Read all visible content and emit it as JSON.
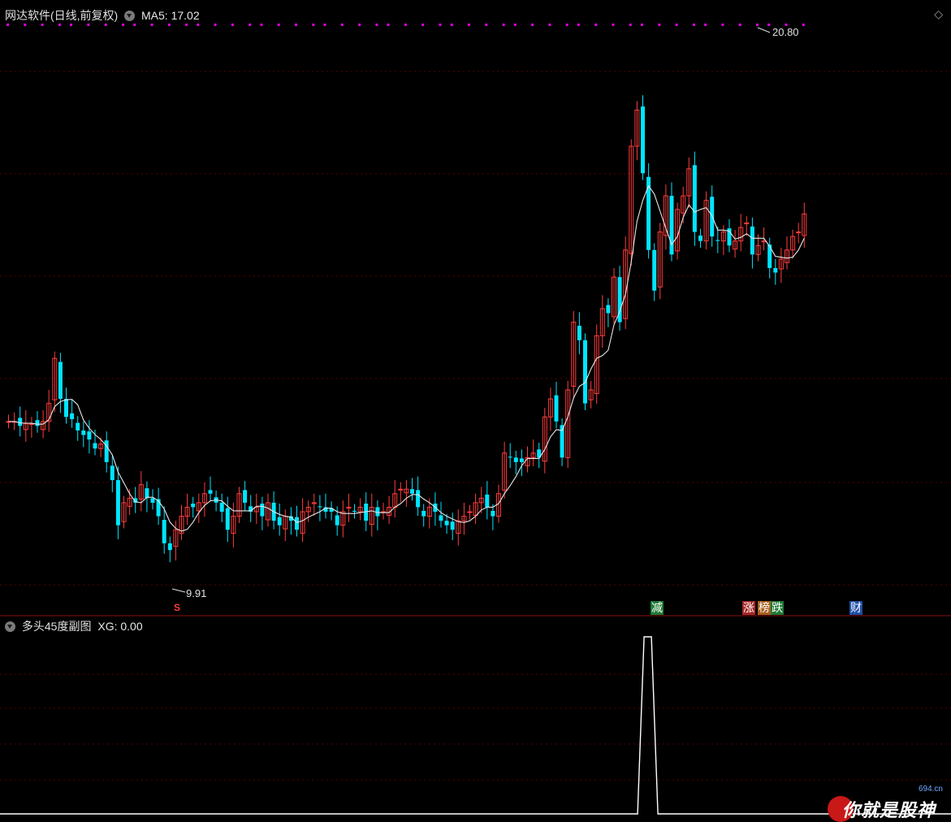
{
  "header": {
    "title": "网达软件(日线,前复权)",
    "ma_label": "MA5: 17.02",
    "diamond": "◇"
  },
  "sub_header": {
    "title": "多头45度副图",
    "xg_label": "XG: 0.00"
  },
  "annotations": {
    "high_label": "20.80",
    "low_label": "9.91",
    "s_marker": "S"
  },
  "event_badges": [
    {
      "label": "减",
      "color": "#2fa84f"
    },
    {
      "label": "涨",
      "color": "#d13a3a"
    },
    {
      "label": "榜",
      "color": "#c27a2a"
    },
    {
      "label": "跌",
      "color": "#2fa84f"
    },
    {
      "label": "财",
      "color": "#2f6fd1"
    }
  ],
  "watermark": {
    "domain": "694.cn",
    "text": "你就是股神"
  },
  "colors": {
    "up": "#ff3d3d",
    "down": "#00e5ff",
    "ma": "#e6e6e6",
    "grid": "#5a0000",
    "signal_dot": "#e000e0"
  },
  "chart_data": {
    "type": "candlestick",
    "title": "网达软件(日线,前复权)",
    "ylim": [
      9.0,
      21.6
    ],
    "high": 20.8,
    "low": 9.91,
    "ma5_last": 17.02,
    "closes": [
      12.8,
      12.8,
      12.7,
      12.75,
      12.75,
      12.7,
      12.8,
      13.2,
      14.2,
      13.3,
      12.9,
      12.85,
      12.6,
      12.5,
      12.4,
      12.2,
      12.3,
      11.9,
      11.5,
      10.5,
      11.0,
      11.1,
      11.0,
      11.4,
      11.1,
      11.0,
      10.7,
      10.1,
      9.95,
      10.4,
      10.7,
      10.9,
      10.9,
      11.0,
      11.2,
      11.2,
      11.0,
      10.8,
      10.4,
      10.7,
      11.2,
      11.0,
      10.8,
      10.9,
      10.7,
      11.0,
      10.6,
      10.5,
      10.7,
      10.6,
      10.4,
      10.8,
      10.9,
      11.0,
      10.9,
      10.8,
      10.8,
      10.5,
      10.8,
      10.9,
      10.8,
      10.9,
      10.6,
      10.9,
      10.7,
      10.8,
      10.9,
      11.2,
      11.3,
      11.3,
      11.2,
      10.9,
      10.7,
      10.9,
      10.8,
      10.6,
      10.5,
      10.4,
      10.6,
      10.7,
      10.8,
      11.0,
      11.1,
      10.9,
      10.7,
      11.2,
      12.1,
      12.0,
      11.9,
      11.9,
      12.0,
      12.1,
      12.0,
      12.9,
      13.3,
      12.8,
      12.0,
      13.5,
      15.0,
      14.6,
      13.2,
      13.5,
      14.7,
      15.3,
      15.2,
      16.0,
      15.0,
      16.6,
      18.9,
      19.7,
      18.3,
      16.6,
      15.7,
      17.0,
      17.8,
      16.5,
      17.5,
      17.8,
      18.4,
      17.0,
      16.8,
      17.7,
      16.9,
      16.8,
      17.0,
      16.7,
      16.8,
      17.1,
      17.2,
      16.5,
      16.7,
      16.8,
      16.2,
      16.1,
      16.4,
      16.6,
      16.9,
      17.0,
      17.4
    ],
    "signals": {
      "xg_spike_index": 111,
      "xg_values": [
        0,
        1
      ],
      "xg_last": 0.0
    }
  }
}
